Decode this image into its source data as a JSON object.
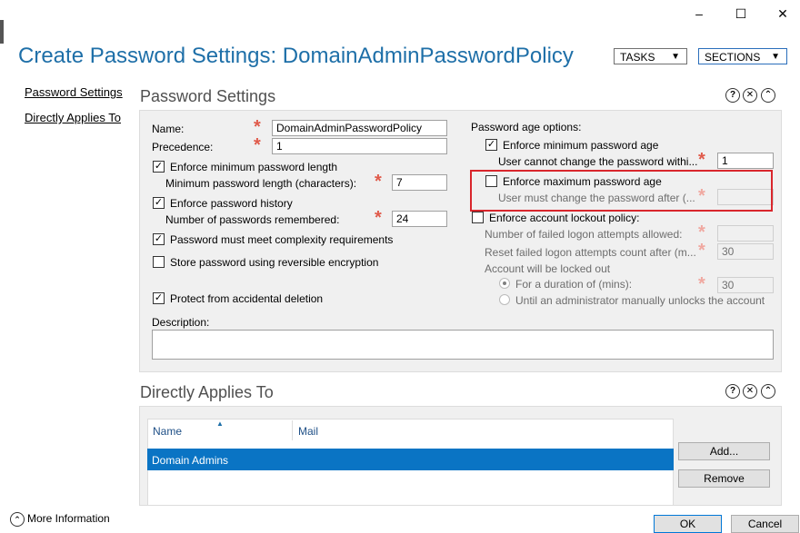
{
  "window": {
    "title": "Create Password Settings: DomainAdminPasswordPolicy",
    "minimize": "–",
    "maximize": "☐",
    "close": "✕"
  },
  "header": {
    "tasks_label": "TASKS",
    "sections_label": "SECTIONS"
  },
  "nav": {
    "items": [
      {
        "label": "Password Settings"
      },
      {
        "label": "Directly Applies To"
      }
    ]
  },
  "password_settings": {
    "heading": "Password Settings",
    "name_label": "Name:",
    "name_value": "DomainAdminPasswordPolicy",
    "precedence_label": "Precedence:",
    "precedence_value": "1",
    "enforce_min_length_label": "Enforce minimum password length",
    "min_length_label": "Minimum password length (characters):",
    "min_length_value": "7",
    "enforce_history_label": "Enforce password history",
    "history_count_label": "Number of passwords remembered:",
    "history_count_value": "24",
    "complexity_label": "Password must meet complexity requirements",
    "reversible_label": "Store password using reversible encryption",
    "protect_label": "Protect from accidental deletion",
    "description_label": "Description:",
    "description_value": "",
    "age_options_label": "Password age options:",
    "enforce_min_age_label": "Enforce minimum password age",
    "min_age_label": "User cannot change the password withi...",
    "min_age_value": "1",
    "enforce_max_age_label": "Enforce maximum password age",
    "max_age_label": "User must change the password after (...",
    "max_age_value": "",
    "lockout_label": "Enforce account lockout policy:",
    "failed_attempts_label": "Number of failed logon attempts allowed:",
    "failed_attempts_value": "",
    "reset_count_label": "Reset failed logon attempts count after (m...",
    "reset_count_value": "30",
    "locked_out_label": "Account will be locked out",
    "duration_label": "For a duration of (mins):",
    "duration_value": "30",
    "until_admin_label": "Until an administrator manually unlocks the account"
  },
  "applies_to": {
    "heading": "Directly Applies To",
    "columns": [
      "Name",
      "Mail"
    ],
    "rows": [
      {
        "name": "Domain Admins",
        "mail": ""
      }
    ],
    "add_label": "Add...",
    "remove_label": "Remove"
  },
  "footer": {
    "more_info_label": "More Information",
    "ok_label": "OK",
    "cancel_label": "Cancel"
  },
  "colors": {
    "title": "#1e6fa8",
    "selection": "#0a74c4",
    "highlight": "#d9262c",
    "required": "#e05a4a"
  }
}
